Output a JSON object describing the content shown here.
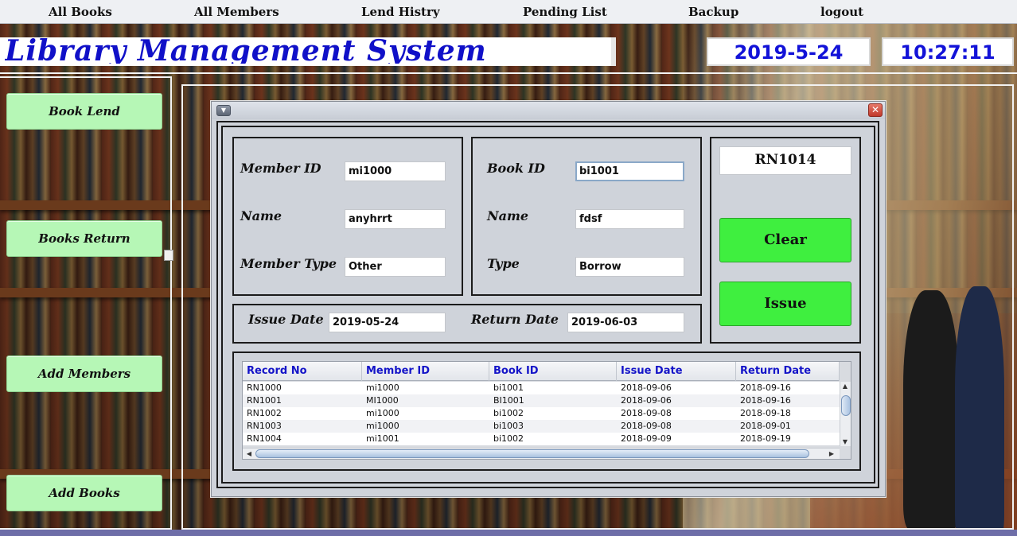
{
  "menu": {
    "items": [
      "All Books",
      "All Members",
      "Lend Histry",
      "Pending List",
      "Backup",
      "logout"
    ]
  },
  "header": {
    "title": "Library Management System",
    "date": "2019-5-24",
    "time": "10:27:11"
  },
  "sidebar": {
    "buttons": [
      "Book Lend",
      "Books Return",
      "Add Members",
      "Add Books"
    ]
  },
  "dialog": {
    "member": {
      "id_label": "Member ID",
      "id_value": "mi1000",
      "name_label": "Name",
      "name_value": "anyhrrt",
      "type_label": "Member Type",
      "type_value": "Other"
    },
    "book": {
      "id_label": "Book ID",
      "id_value": "bi1001",
      "name_label": "Name",
      "name_value": "fdsf",
      "type_label": "Type",
      "type_value": "Borrow"
    },
    "dates": {
      "issue_label": "Issue Date",
      "issue_value": "2019-05-24",
      "return_label": "Return Date",
      "return_value": "2019-06-03"
    },
    "record_no": "RN1014",
    "clear_label": "Clear",
    "issue_label": "Issue",
    "table": {
      "columns": [
        "Record No",
        "Member ID",
        "Book ID",
        "Issue Date",
        "Return Date"
      ],
      "rows": [
        [
          "RN1000",
          "mi1000",
          "bi1001",
          "2018-09-06",
          "2018-09-16"
        ],
        [
          "RN1001",
          "MI1000",
          "BI1001",
          "2018-09-06",
          "2018-09-16"
        ],
        [
          "RN1002",
          "mi1000",
          "bi1002",
          "2018-09-08",
          "2018-09-18"
        ],
        [
          "RN1003",
          "mi1000",
          "bi1003",
          "2018-09-08",
          "2018-09-01"
        ],
        [
          "RN1004",
          "mi1001",
          "bi1002",
          "2018-09-09",
          "2018-09-19"
        ]
      ]
    }
  },
  "colors": {
    "title_blue": "#1010c8",
    "sidebar_button": "#b6f7b6",
    "action_button": "#3fef3f",
    "table_header_text": "#1414c8"
  }
}
